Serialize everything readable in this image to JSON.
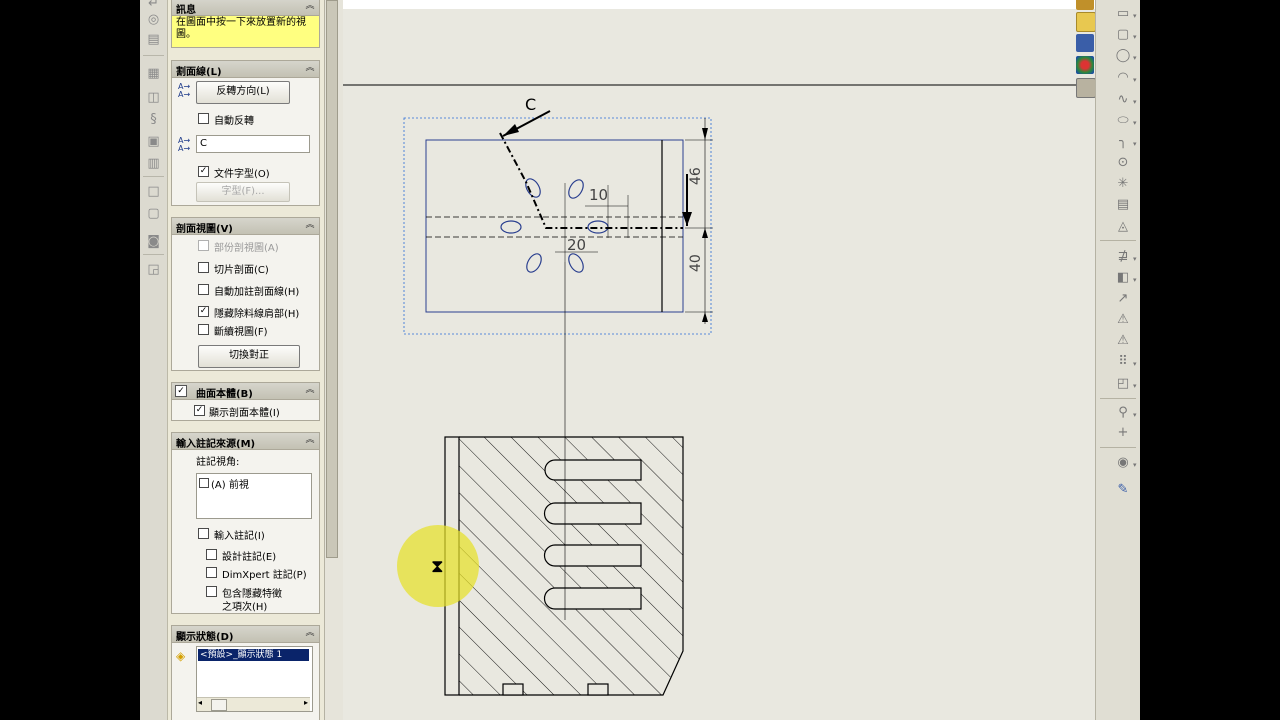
{
  "message": {
    "header": "訊息",
    "text": "在圖面中按一下來放置新的視圖。"
  },
  "cutting_line": {
    "header": "割面線(L)",
    "flip_button": "反轉方向(L)",
    "auto_flip": "自動反轉",
    "label_value": "C",
    "doc_font": "文件字型(O)",
    "font_button": "字型(F)..."
  },
  "section_view": {
    "header": "剖面視圖(V)",
    "partial": "部份剖視圖(A)",
    "slice": "切片剖面(C)",
    "auto_hatch": "自動加註剖面線(H)",
    "hide_cut": "隱藏除料線肩部(H)",
    "broken": "斷續視圖(F)",
    "toggle_button": "切換對正"
  },
  "surface_bodies": {
    "header": "曲面本體(B)",
    "show": "顯示剖面本體(I)"
  },
  "import_annotations": {
    "header": "輸入註記來源(M)",
    "view_label": "註記視角:",
    "views": [
      "(A) 前視"
    ],
    "import": "輸入註記(I)",
    "design": "設計註記(E)",
    "dimxpert": "DimXpert 註記(P)",
    "hidden_line1": "包含隱藏特徵",
    "hidden_line2": "之項次(H)"
  },
  "display_state": {
    "header": "顯示狀態(D)",
    "selected": "<預設>_顯示狀態 1"
  },
  "drawing": {
    "section_label": "C",
    "dim_10": "10",
    "dim_20": "20",
    "dim_40": "40",
    "dim_46": "46"
  },
  "colors": {
    "accent": "#0a246a",
    "message_bg": "#ffff80",
    "line": "#000000",
    "feature_blue": "#2a3f8f",
    "highlight": "#e6e128"
  }
}
